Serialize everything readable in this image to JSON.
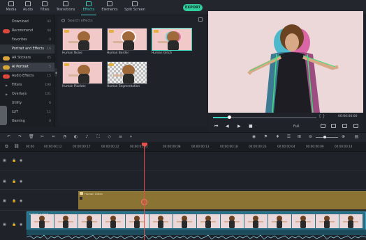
{
  "toolbar": {
    "tabs": [
      {
        "label": "Media",
        "icon": "folder-icon"
      },
      {
        "label": "Audio",
        "icon": "music-icon"
      },
      {
        "label": "Titles",
        "icon": "text-icon"
      },
      {
        "label": "Transitions",
        "icon": "transition-icon"
      },
      {
        "label": "Effects",
        "icon": "effects-icon",
        "active": true
      },
      {
        "label": "Elements",
        "icon": "elements-icon"
      },
      {
        "label": "Split Screen",
        "icon": "split-screen-icon"
      }
    ],
    "export_label": "EXPORT"
  },
  "sidebar": {
    "items": [
      {
        "label": "Download",
        "count": "42"
      },
      {
        "label": "Recommend",
        "count": "44",
        "badge": "new"
      },
      {
        "label": "Favorites",
        "count": "0"
      },
      {
        "label": "Portrait and Effects",
        "count": "16"
      },
      {
        "label": "AR Stickers",
        "count": "45",
        "badge": "gold"
      },
      {
        "label": "AI Portrait",
        "count": "5",
        "badge": "gold",
        "selected": true
      },
      {
        "label": "Audio Effects",
        "count": "15",
        "badge": "new"
      },
      {
        "label": "Filters",
        "count": "190",
        "expandable": true
      },
      {
        "label": "Overlays",
        "count": "101",
        "expandable": true
      },
      {
        "label": "Utility",
        "count": "6"
      },
      {
        "label": "LUT",
        "count": "11"
      },
      {
        "label": "Gaming",
        "count": "8"
      }
    ]
  },
  "effects": {
    "search_placeholder": "Search effects",
    "items": [
      {
        "label": "Human Noise"
      },
      {
        "label": "Human Border"
      },
      {
        "label": "Human Glitch"
      },
      {
        "label": "Human Pixelate"
      },
      {
        "label": "Human Segmentation"
      }
    ]
  },
  "preview": {
    "brace_glyph": "{  }",
    "timecode": "00:00:00:00",
    "quality": "Full",
    "controls": {
      "prev": "⏮",
      "play_back": "◀",
      "play": "▶",
      "stop": "■"
    }
  },
  "timeline": {
    "ruler": [
      "00:00",
      "00:00:00:12",
      "00:00:00:17",
      "00:00:00:22",
      "00:00:01:03",
      "00:00:00:08",
      "00:00:00:13",
      "00:00:00:18",
      "00:00:00:23",
      "00:00:00:04",
      "00:00:00:09",
      "00:00:00:14"
    ],
    "effect_clip_label": "Human Glitch",
    "video_clip_label": "Cutout_1.mp4"
  },
  "colors": {
    "accent": "#3ad1bf",
    "export": "#2fcf9e",
    "playhead": "#e7504a",
    "effect_clip": "#8b7334",
    "video_clip": "#2b6f86"
  }
}
